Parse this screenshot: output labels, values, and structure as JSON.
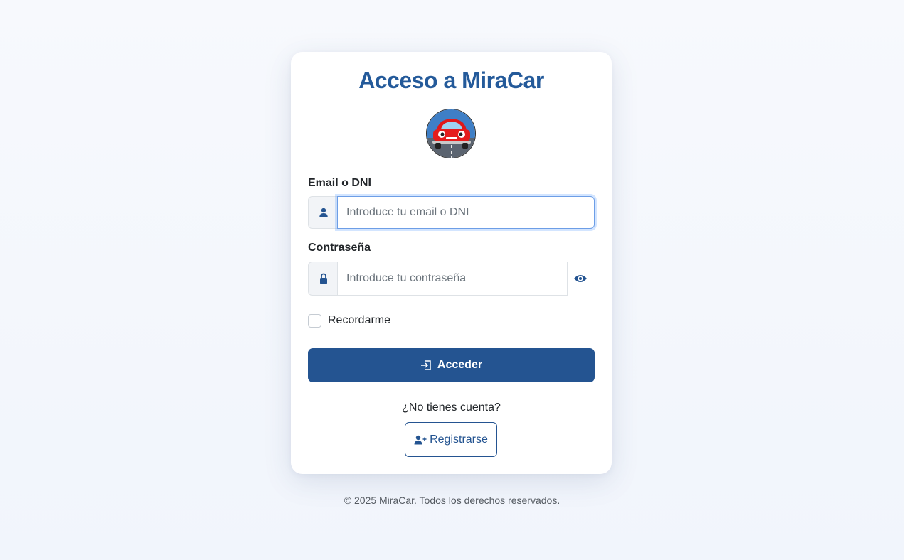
{
  "title": "Acceso a MiraCar",
  "logo": {
    "name": "car-logo",
    "description_icon": "red-car-icon"
  },
  "email": {
    "label": "Email o DNI",
    "placeholder": "Introduce tu email o DNI",
    "value": "",
    "icon": "user-icon"
  },
  "password": {
    "label": "Contraseña",
    "placeholder": "Introduce tu contraseña",
    "value": "",
    "icon": "lock-icon",
    "toggle_icon": "eye-icon"
  },
  "remember": {
    "label": "Recordarme",
    "checked": false
  },
  "login_button": {
    "label": "Acceder",
    "icon": "sign-in-icon"
  },
  "register": {
    "prompt": "¿No tienes cuenta?",
    "button_label": "Registrarse",
    "icon": "user-plus-icon"
  },
  "footer": "© 2025 MiraCar. Todos los derechos reservados.",
  "colors": {
    "brand": "#245491",
    "title": "#245a9a",
    "background": "#f4f7fc"
  }
}
